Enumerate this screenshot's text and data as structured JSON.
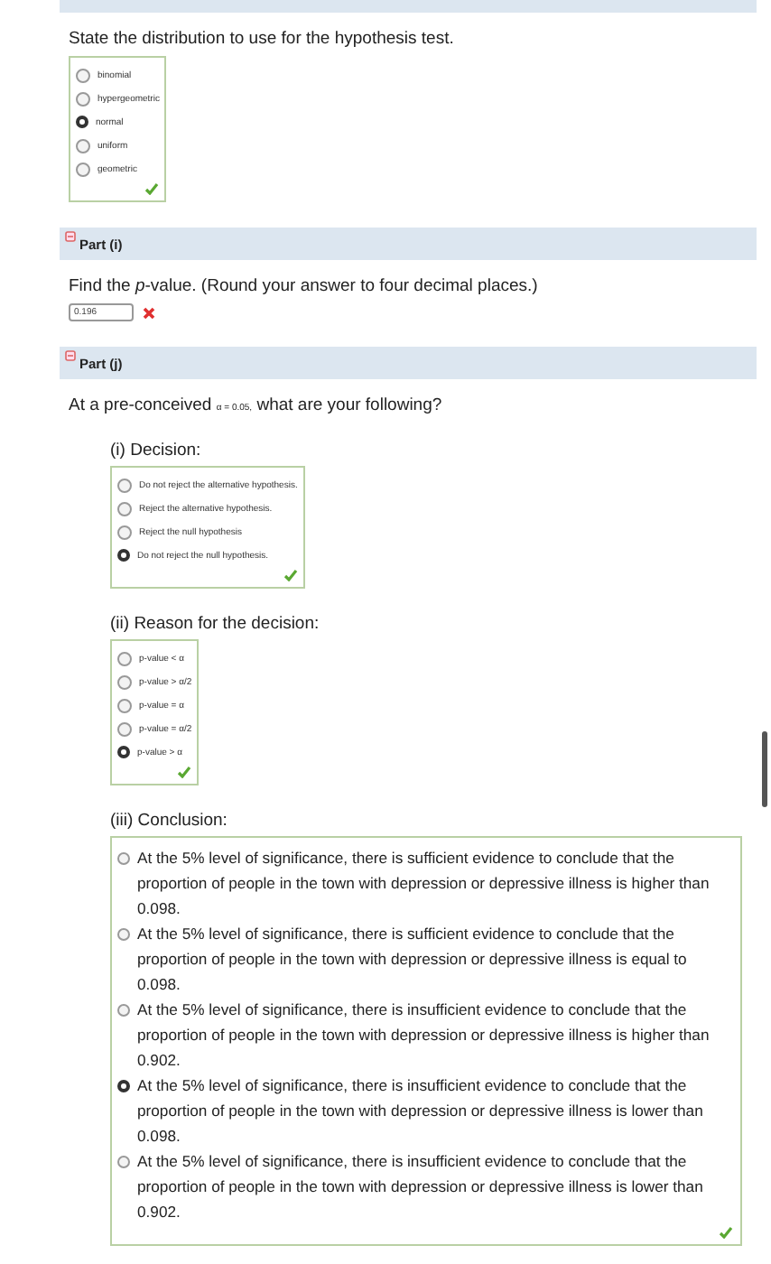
{
  "distribution": {
    "prompt": "State the distribution to use for the hypothesis test.",
    "correct": true,
    "options": [
      {
        "label": "binomial",
        "selected": false
      },
      {
        "label": "hypergeometric",
        "selected": false
      },
      {
        "label": "normal",
        "selected": true
      },
      {
        "label": "uniform",
        "selected": false
      },
      {
        "label": "geometric",
        "selected": false
      }
    ]
  },
  "part_i": {
    "title": "Part (i)",
    "expanded": true,
    "prompt": "Find the *p*-value. (Round your answer to four decimal places.)",
    "value": "0.196",
    "correct": false
  },
  "part_j": {
    "title": "Part (j)",
    "expanded": true,
    "prompt_start": "At a pre-conceived",
    "alpha": "α = 0.05,",
    "prompt_end": "what are your following?",
    "questions": [
      {
        "label": "(i) Decision:",
        "kind": "compact",
        "correct": true,
        "options": [
          {
            "label": "Do not reject the alternative hypothesis.",
            "selected": false
          },
          {
            "label": "Reject the alternative hypothesis.",
            "selected": false
          },
          {
            "label": "Reject the null hypothesis",
            "selected": false
          },
          {
            "label": "Do not reject the null hypothesis.",
            "selected": true
          }
        ]
      },
      {
        "label": "(ii) Reason for the decision:",
        "kind": "compact",
        "correct": true,
        "options": [
          {
            "label": "p-value < α",
            "selected": false
          },
          {
            "label": "p-value > α/2",
            "selected": false
          },
          {
            "label": "p-value = α",
            "selected": false
          },
          {
            "label": "p-value = α/2",
            "selected": false
          },
          {
            "label": "p-value > α",
            "selected": true
          }
        ]
      },
      {
        "label": "(iii) Conclusion:",
        "kind": "wide",
        "correct": true,
        "options": [
          {
            "label": "At the 5% level of significance, there is sufficient evidence to conclude that the proportion of people in the town with depression or depressive illness is higher than 0.098.",
            "selected": false
          },
          {
            "label": "At the 5% level of significance, there is sufficient evidence to conclude that the proportion of people in the town with depression or depressive illness is equal to 0.098.",
            "selected": false
          },
          {
            "label": "At the 5% level of significance, there is insufficient evidence to conclude that the proportion of people in the town with depression or depressive illness is higher than 0.902.",
            "selected": false
          },
          {
            "label": "At the 5% level of significance, there is insufficient evidence to conclude that the proportion of people in the town with depression or depressive illness is lower than 0.098.",
            "selected": true
          },
          {
            "label": "At the 5% level of significance, there is insufficient evidence to conclude that the proportion of people in the town with depression or depressive illness is lower than 0.902.",
            "selected": false
          }
        ]
      }
    ]
  }
}
